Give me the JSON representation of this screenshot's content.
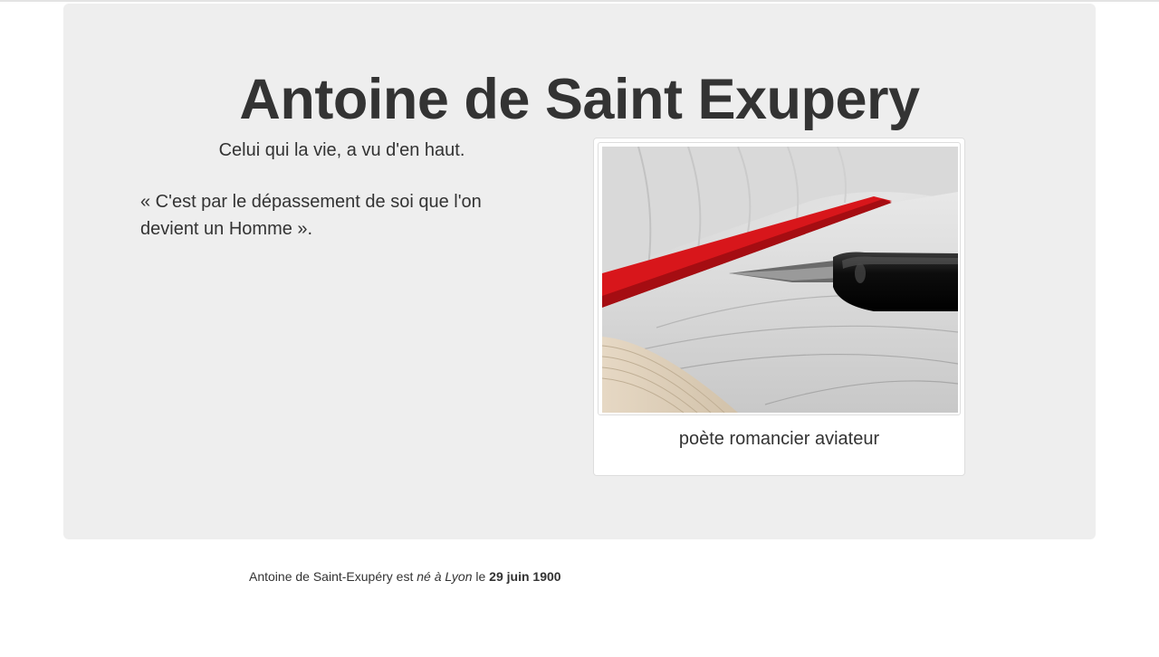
{
  "header": {
    "title": "Antoine de Saint Exupery"
  },
  "intro": {
    "tagline": "Celui qui la vie, a vu d'en haut.",
    "quote": "« C'est par le dépassement de soi que l'on devient un Homme »."
  },
  "thumbnail": {
    "image_icon": "fountain-pen-notebook-image",
    "caption": "poète romancier aviateur"
  },
  "footer": {
    "part1": "Antoine de Saint-Exupéry est ",
    "part2_italic": "né à Lyon",
    "part3": " le ",
    "part4_bold": "29 juin 1900"
  }
}
